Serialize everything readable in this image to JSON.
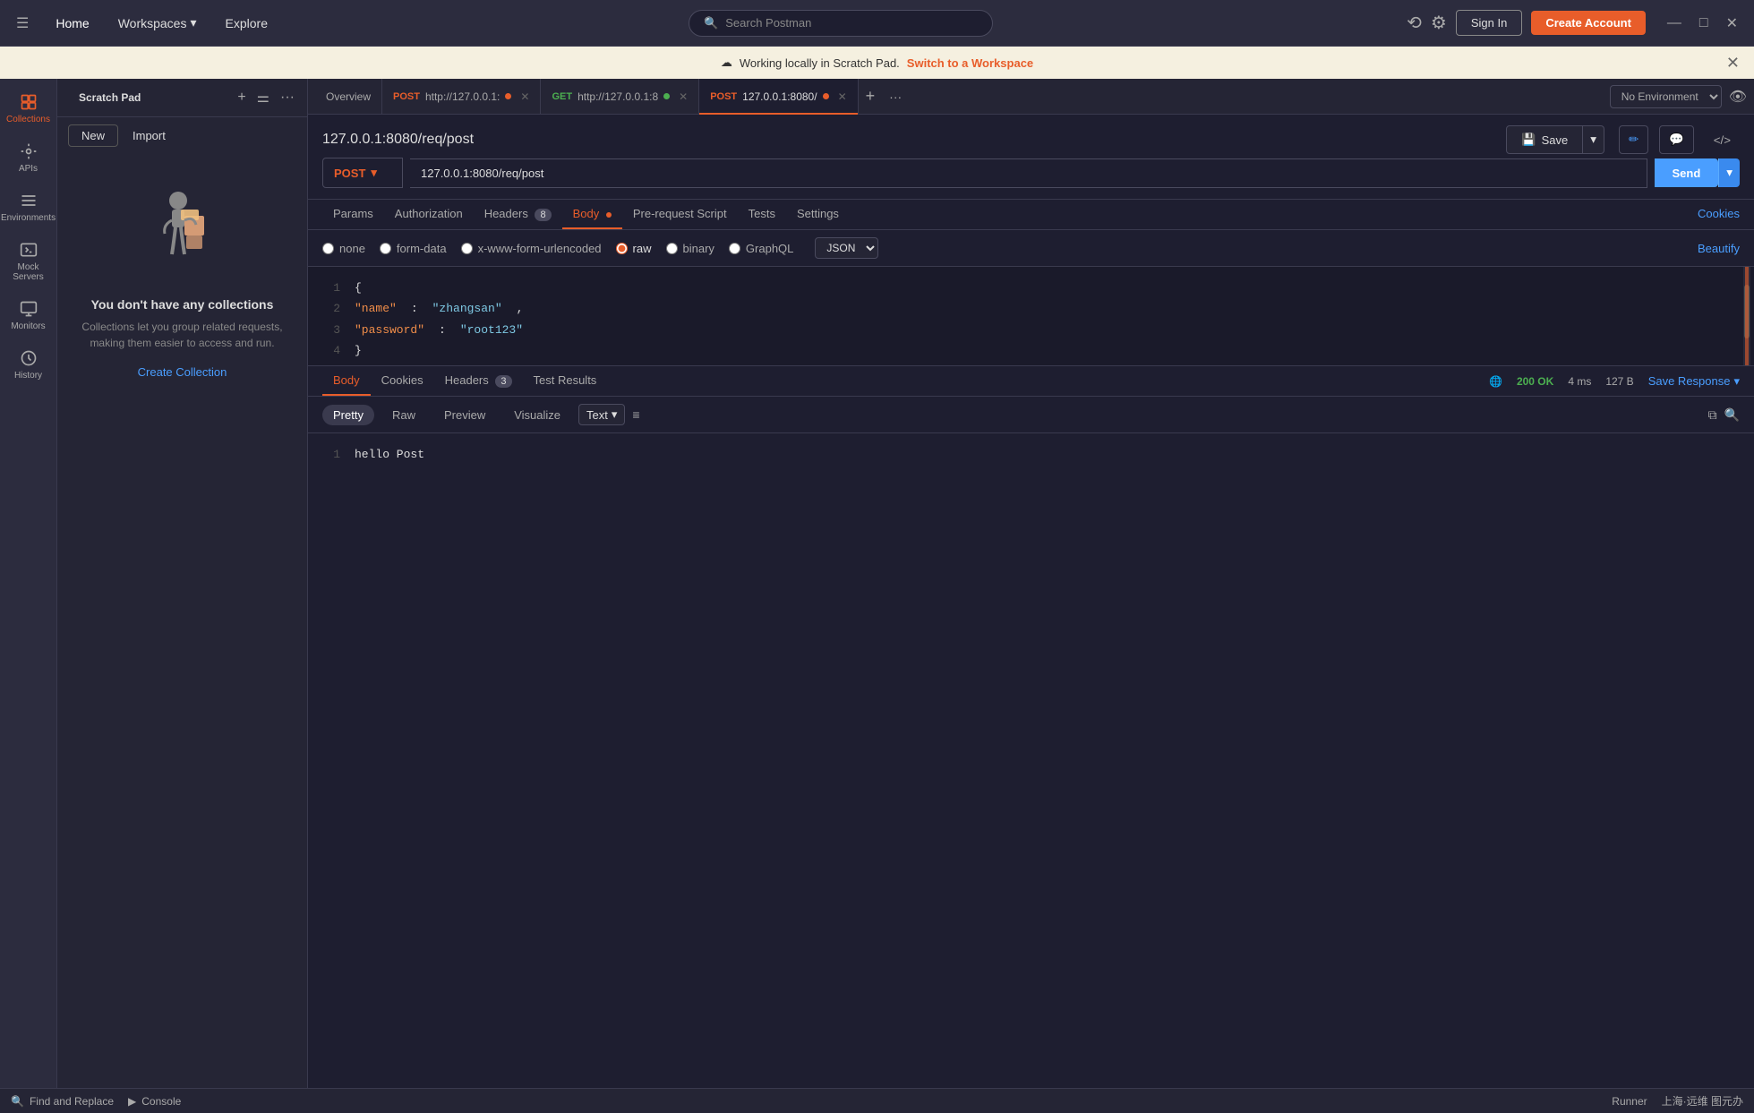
{
  "titlebar": {
    "hamburger": "☰",
    "home": "Home",
    "workspaces": "Workspaces",
    "workspaces_arrow": "▾",
    "explore": "Explore",
    "search_placeholder": "Search Postman",
    "sign_in": "Sign In",
    "create_account": "Create Account",
    "minimize": "—",
    "maximize": "□",
    "close": "✕"
  },
  "banner": {
    "icon": "☁",
    "text": "Working locally in Scratch Pad.",
    "link_text": "Switch to a Workspace",
    "close": "✕"
  },
  "sidebar": {
    "items": [
      {
        "id": "collections",
        "label": "Collections",
        "icon": "collections"
      },
      {
        "id": "apis",
        "label": "APIs",
        "icon": "api"
      },
      {
        "id": "environments",
        "label": "Environments",
        "icon": "env"
      },
      {
        "id": "mock-servers",
        "label": "Mock Servers",
        "icon": "mock"
      },
      {
        "id": "monitors",
        "label": "Monitors",
        "icon": "monitor"
      },
      {
        "id": "history",
        "label": "History",
        "icon": "history"
      }
    ]
  },
  "collections_panel": {
    "title": "Scratch Pad",
    "new_btn": "New",
    "import_btn": "Import",
    "empty_title": "You don't have any collections",
    "empty_desc": "Collections let you group related requests, making them easier to access and run.",
    "create_link": "Create Collection"
  },
  "tabs": {
    "overview": "Overview",
    "tab1_method": "POST",
    "tab1_url": "http://127.0.0.1:",
    "tab1_dot": "orange",
    "tab2_method": "GET",
    "tab2_url": "http://127.0.0.1:8",
    "tab2_dot": "green",
    "tab3_method": "POST",
    "tab3_url": "127.0.0.1:8080/",
    "tab3_dot": "orange",
    "add": "+",
    "more": "···",
    "env_label": "No Environment",
    "env_arrow": "▾"
  },
  "request": {
    "path": "127.0.0.1:8080/req/post",
    "save_icon": "💾",
    "save_label": "Save",
    "save_arrow": "▾",
    "edit_icon": "✏",
    "comment_icon": "💬",
    "code_icon": "</>",
    "method": "POST",
    "method_arrow": "▾",
    "url": "127.0.0.1:8080/req/post",
    "send_label": "Send",
    "send_arrow": "▾"
  },
  "request_tabs": {
    "params": "Params",
    "authorization": "Authorization",
    "headers": "Headers",
    "headers_count": "8",
    "body": "Body",
    "pre_request": "Pre-request Script",
    "tests": "Tests",
    "settings": "Settings",
    "cookies": "Cookies"
  },
  "body_options": {
    "none": "none",
    "form_data": "form-data",
    "urlencoded": "x-www-form-urlencoded",
    "raw": "raw",
    "binary": "binary",
    "graphql": "GraphQL",
    "json_format": "JSON",
    "json_arrow": "▾",
    "beautify": "Beautify"
  },
  "code_editor": {
    "lines": [
      {
        "num": "1",
        "content": "{"
      },
      {
        "num": "2",
        "content": "    \"name\": \"zhangsan\","
      },
      {
        "num": "3",
        "content": "    \"password\": \"root123\""
      },
      {
        "num": "4",
        "content": "}"
      }
    ],
    "line2_key": "\"name\"",
    "line2_colon": ":",
    "line2_val": "\"zhangsan\"",
    "line3_key": "\"password\"",
    "line3_colon": ":",
    "line3_val": "\"root123\""
  },
  "response": {
    "body_tab": "Body",
    "cookies_tab": "Cookies",
    "headers_tab": "Headers",
    "headers_count": "3",
    "test_results_tab": "Test Results",
    "status": "200 OK",
    "time": "4 ms",
    "size": "127 B",
    "save_response": "Save Response",
    "save_arrow": "▾",
    "globe_icon": "🌐",
    "formats": {
      "pretty": "Pretty",
      "raw": "Raw",
      "preview": "Preview",
      "visualize": "Visualize"
    },
    "text_format": "Text",
    "text_arrow": "▾",
    "wrap_icon": "≡",
    "copy_icon": "⧉",
    "search_icon": "🔍",
    "content_line": "hello Post",
    "line_num": "1"
  },
  "bottom_bar": {
    "find_replace_icon": "🔍",
    "find_replace": "Find and Replace",
    "console_icon": "▶",
    "console": "Console",
    "runner_label": "Runner",
    "right_text": "上海·远维 图元办"
  }
}
